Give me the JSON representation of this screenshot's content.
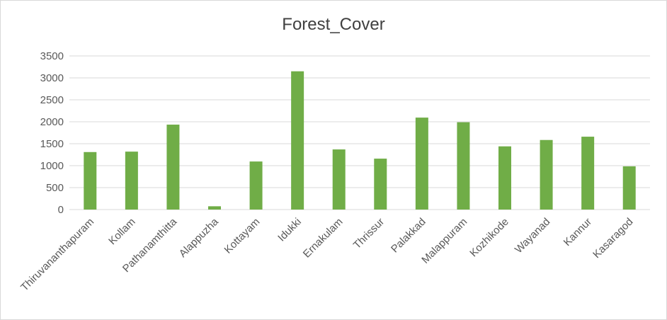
{
  "chart_data": {
    "type": "bar",
    "title": "Forest_Cover",
    "xlabel": "",
    "ylabel": "",
    "categories": [
      "Thiruvananthapuram",
      "Kollam",
      "Pathanamthitta",
      "Alappuzha",
      "Kottayam",
      "Idukki",
      "Ernakulam",
      "Thrissur",
      "Palakkad",
      "Malappuram",
      "Kozhikode",
      "Wayanad",
      "Kannur",
      "Kasaragod"
    ],
    "values": [
      1310,
      1320,
      1935,
      75,
      1095,
      3150,
      1370,
      1160,
      2095,
      1990,
      1440,
      1585,
      1660,
      985
    ],
    "ylim": [
      0,
      3500
    ],
    "yticks": [
      "0",
      "500",
      "1000",
      "1500",
      "2000",
      "2500",
      "3000",
      "3500"
    ],
    "grid": true,
    "legend": "none",
    "bar_color": "#70ad47",
    "grid_color": "#d9d9d9"
  }
}
